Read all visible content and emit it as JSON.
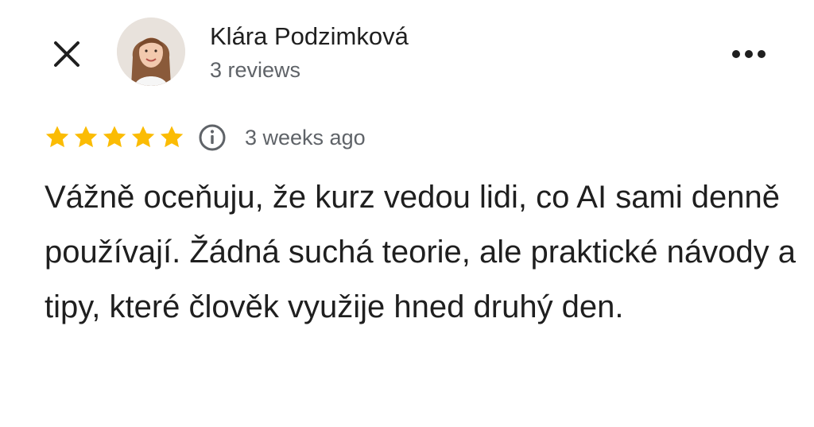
{
  "header": {
    "close_icon": "close-icon",
    "more_icon": "more-horizontal-icon"
  },
  "reviewer": {
    "name": "Klára Podzimková",
    "review_count": "3 reviews",
    "avatar_icon": "avatar-photo"
  },
  "review": {
    "rating": 5,
    "rating_max": 5,
    "star_color": "#fbbc04",
    "info_icon": "info-icon",
    "date": "3 weeks ago",
    "text": "Vážně oceňuju, že kurz vedou lidi, co AI sami denně používají. Žádná suchá teorie, ale praktické návody a tipy, které člověk využije hned druhý den."
  }
}
